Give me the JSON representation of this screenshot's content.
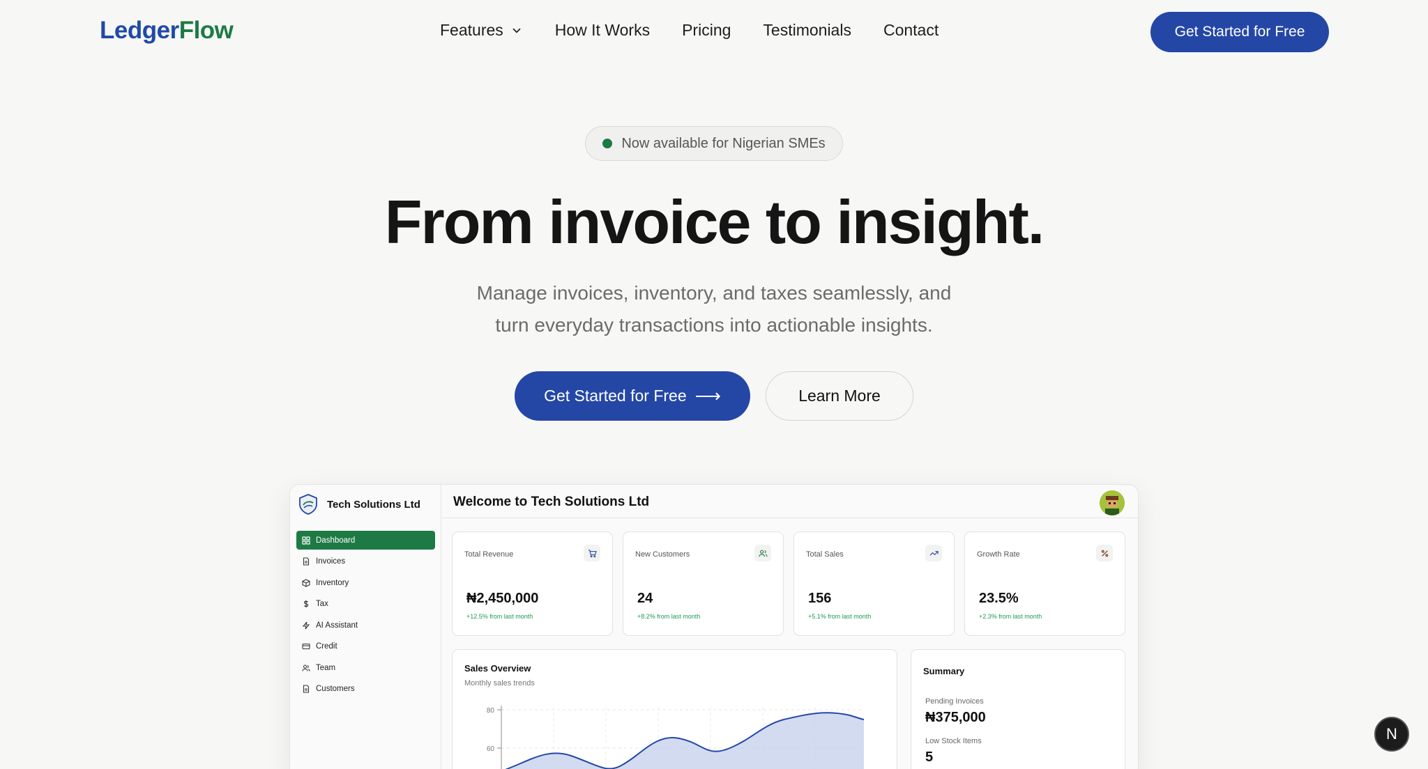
{
  "header": {
    "logo_part1": "Ledger",
    "logo_part2": "Flow",
    "nav": [
      {
        "label": "Features",
        "has_dropdown": true
      },
      {
        "label": "How It Works"
      },
      {
        "label": "Pricing"
      },
      {
        "label": "Testimonials"
      },
      {
        "label": "Contact"
      }
    ],
    "cta_label": "Get Started for Free"
  },
  "hero": {
    "badge": "Now available for Nigerian SMEs",
    "title": "From invoice to insight.",
    "subtitle_line1": "Manage invoices, inventory, and taxes seamlessly, and",
    "subtitle_line2": "turn everyday transactions into actionable insights.",
    "primary_button": "Get Started for Free",
    "primary_arrow": "⟶",
    "secondary_button": "Learn More"
  },
  "dashboard": {
    "org_name": "Tech Solutions Ltd",
    "welcome": "Welcome to Tech Solutions Ltd",
    "sidebar": [
      {
        "label": "Dashboard",
        "icon": "grid-icon",
        "active": true
      },
      {
        "label": "Invoices",
        "icon": "file-icon"
      },
      {
        "label": "Inventory",
        "icon": "box-icon"
      },
      {
        "label": "Tax",
        "icon": "dollar-icon"
      },
      {
        "label": "AI Assistant",
        "icon": "bolt-icon"
      },
      {
        "label": "Credit",
        "icon": "card-icon"
      },
      {
        "label": "Team",
        "icon": "users-icon"
      },
      {
        "label": "Customers",
        "icon": "file-icon"
      }
    ],
    "stats": [
      {
        "label": "Total Revenue",
        "value": "₦2,450,000",
        "delta": "+12.5% from last month",
        "icon": "cart-icon"
      },
      {
        "label": "New Customers",
        "value": "24",
        "delta": "+8.2% from last month",
        "icon": "users-icon"
      },
      {
        "label": "Total Sales",
        "value": "156",
        "delta": "+5.1% from last month",
        "icon": "trend-icon"
      },
      {
        "label": "Growth Rate",
        "value": "23.5%",
        "delta": "+2.3% from last month",
        "icon": "percent-icon"
      }
    ],
    "sales": {
      "title": "Sales Overview",
      "subtitle": "Monthly sales trends",
      "y_ticks": [
        "80",
        "60"
      ]
    },
    "summary": {
      "title": "Summary",
      "pending_label": "Pending Invoices",
      "pending_value": "₦375,000",
      "low_stock_label": "Low Stock Items",
      "low_stock_value": "5"
    }
  },
  "overlay": {
    "next_badge": "N"
  },
  "colors": {
    "primary": "#2447a6",
    "brand_green": "#1e7a44",
    "delta_green": "#1e9a52"
  }
}
